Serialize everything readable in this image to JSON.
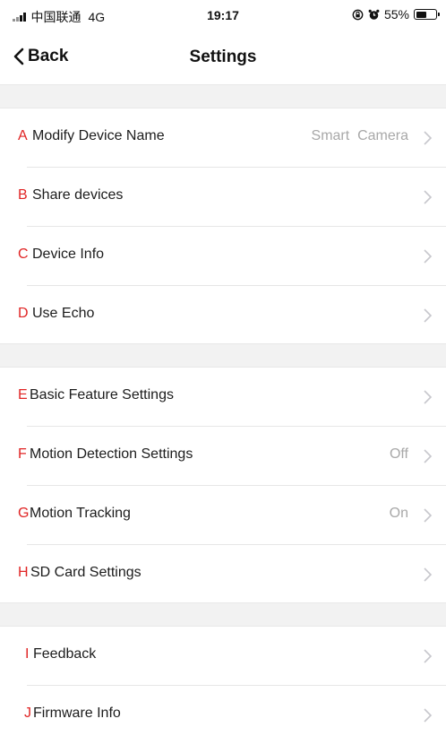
{
  "status_bar": {
    "carrier": "中国联通",
    "network": "4G",
    "time": "19:17",
    "battery": "55%",
    "battery_level": 0.55
  },
  "nav": {
    "back_label": "Back",
    "title": "Settings"
  },
  "rows": [
    {
      "letter": "A",
      "label": "Modify Device Name",
      "value": "Smart  Camera"
    },
    {
      "letter": "B",
      "label": "Share devices",
      "value": ""
    },
    {
      "letter": "C",
      "label": "Device Info",
      "value": ""
    },
    {
      "letter": "D",
      "label": "Use Echo",
      "value": ""
    },
    {
      "letter": "E",
      "label": "Basic Feature Settings",
      "value": ""
    },
    {
      "letter": "F",
      "label": "Motion Detection Settings",
      "value": "Off"
    },
    {
      "letter": "G",
      "label": "Motion Tracking",
      "value": "On"
    },
    {
      "letter": "H",
      "label": "SD Card Settings",
      "value": ""
    },
    {
      "letter": "I",
      "label": "Feedback",
      "value": ""
    },
    {
      "letter": "J",
      "label": "Firmware Info",
      "value": ""
    }
  ],
  "colors": {
    "letter_marker": "#e02424",
    "section_background": "#f2f2f2",
    "value_text": "#a8a8a8"
  },
  "icons": {
    "back": "chevron-left-icon",
    "row_arrow": "chevron-right-icon",
    "orientation_lock": "orientation-lock-icon",
    "alarm": "alarm-clock-icon",
    "battery": "battery-icon",
    "signal": "signal-bars-icon"
  }
}
